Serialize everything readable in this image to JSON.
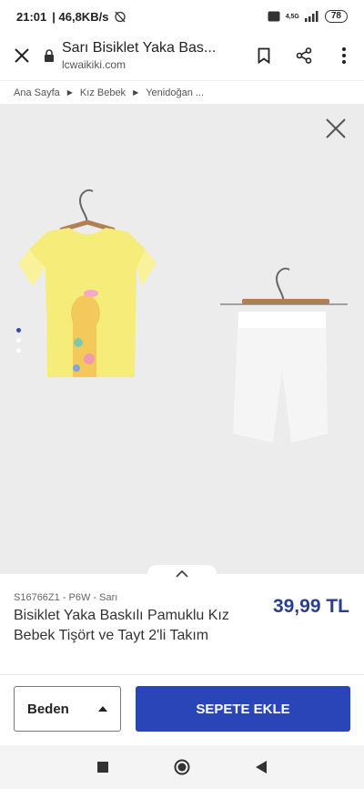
{
  "status_bar": {
    "time": "21:01",
    "speed": "| 46,8KB/s",
    "battery": "78",
    "network": "4,5G"
  },
  "browser": {
    "page_title": "Sarı Bisiklet Yaka Bas...",
    "domain": "lcwaikiki.com",
    "close_icon": "close-icon",
    "lock_icon": "lock-icon",
    "bookmark_icon": "bookmark-icon",
    "share_icon": "share-icon",
    "menu_icon": "more-vertical-icon"
  },
  "breadcrumb": {
    "items": [
      "Ana Sayfa",
      "Kız Bebek",
      "Yenidoğan ..."
    ]
  },
  "gallery": {
    "image_count": 3,
    "active_index": 0
  },
  "product": {
    "sku": "S16766Z1 - P6W - Sarı",
    "name": "Bisiklet Yaka Baskılı Pamuklu Kız Bebek Tişört ve Tayt 2'li Takım",
    "price": "39,99 TL"
  },
  "actions": {
    "size_label": "Beden",
    "add_to_cart": "SEPETE EKLE"
  },
  "colors": {
    "accent": "#2a45b8",
    "price": "#2a3f8f",
    "shirt": "#f5ec7a",
    "leggings": "#f4f4f4"
  }
}
